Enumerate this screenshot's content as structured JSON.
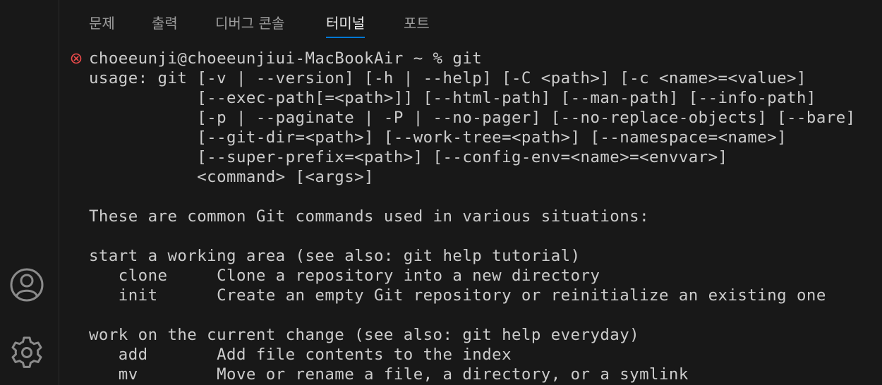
{
  "panel": {
    "tabs": [
      {
        "label": "문제",
        "active": false
      },
      {
        "label": "출력",
        "active": false
      },
      {
        "label": "디버그 콘솔",
        "active": false
      },
      {
        "label": "터미널",
        "active": true
      },
      {
        "label": "포트",
        "active": false
      }
    ]
  },
  "activity_bar": {
    "icons": [
      "accounts-icon",
      "settings-icon"
    ]
  },
  "terminal": {
    "prompt_status": "error",
    "prompt_status_color": "#f14c4c",
    "lines": [
      "choeeunji@choeeunjiui-MacBookAir ~ % git",
      "usage: git [-v | --version] [-h | --help] [-C <path>] [-c <name>=<value>]",
      "           [--exec-path[=<path>]] [--html-path] [--man-path] [--info-path]",
      "           [-p | --paginate | -P | --no-pager] [--no-replace-objects] [--bare]",
      "           [--git-dir=<path>] [--work-tree=<path>] [--namespace=<name>]",
      "           [--super-prefix=<path>] [--config-env=<name>=<envvar>]",
      "           <command> [<args>]",
      "",
      "These are common Git commands used in various situations:",
      "",
      "start a working area (see also: git help tutorial)",
      "   clone     Clone a repository into a new directory",
      "   init      Create an empty Git repository or reinitialize an existing one",
      "",
      "work on the current change (see also: git help everyday)",
      "   add       Add file contents to the index",
      "   mv        Move or rename a file, a directory, or a symlink"
    ]
  },
  "colors": {
    "background": "#181818",
    "foreground": "#cccccc",
    "tab_inactive": "#9d9d9d",
    "tab_active": "#e7e7e7",
    "tab_underline": "#0078d4",
    "error": "#f14c4c"
  }
}
